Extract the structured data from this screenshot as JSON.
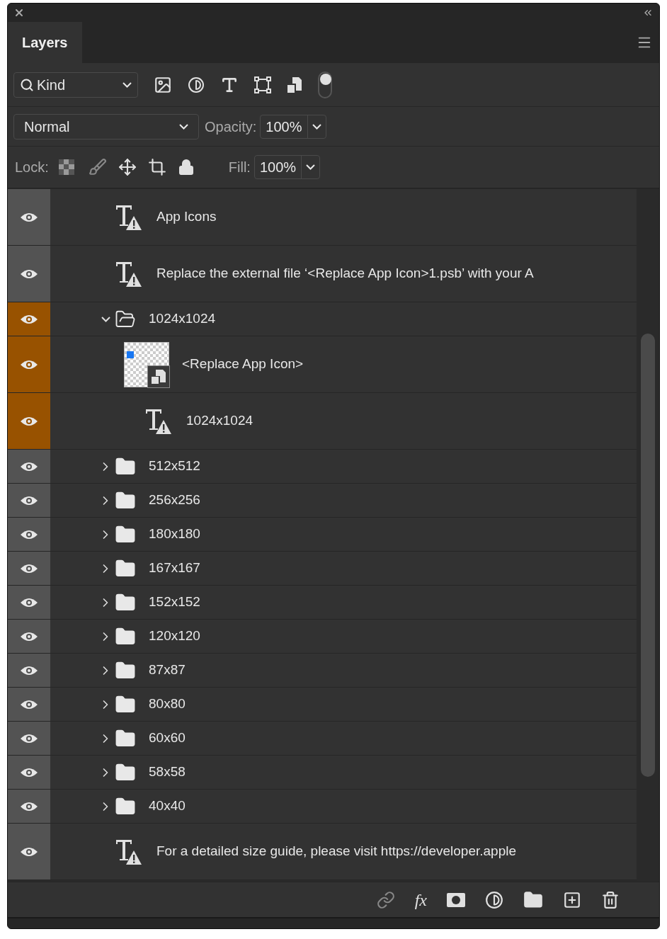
{
  "tab": {
    "label": "Layers",
    "selected": true
  },
  "filter": {
    "value": "Kind",
    "toggle_on": true
  },
  "blend": {
    "mode": "Normal",
    "opacity_label": "Opacity:",
    "opacity": "100%"
  },
  "lock": {
    "label": "Lock:",
    "fill_label": "Fill:",
    "fill": "100%"
  },
  "layers": [
    {
      "kind": "text",
      "name": "App Icons",
      "color": "#535353"
    },
    {
      "kind": "text",
      "name": "Replace the external file ‘<Replace App Icon>1.psb’ with your A",
      "color": "#535353"
    },
    {
      "kind": "folder",
      "name": "1024x1024",
      "color": "#985200",
      "expanded": true,
      "children": [
        {
          "kind": "smart",
          "name": "<Replace App Icon>",
          "color": "#985200"
        },
        {
          "kind": "text",
          "name": "1024x1024",
          "color": "#985200"
        }
      ]
    },
    {
      "kind": "folder",
      "name": "512x512",
      "color": "#535353",
      "expanded": false
    },
    {
      "kind": "folder",
      "name": "256x256",
      "color": "#535353",
      "expanded": false
    },
    {
      "kind": "folder",
      "name": "180x180",
      "color": "#535353",
      "expanded": false
    },
    {
      "kind": "folder",
      "name": "167x167",
      "color": "#535353",
      "expanded": false
    },
    {
      "kind": "folder",
      "name": "152x152",
      "color": "#535353",
      "expanded": false
    },
    {
      "kind": "folder",
      "name": "120x120",
      "color": "#535353",
      "expanded": false
    },
    {
      "kind": "folder",
      "name": "87x87",
      "color": "#535353",
      "expanded": false
    },
    {
      "kind": "folder",
      "name": "80x80",
      "color": "#535353",
      "expanded": false
    },
    {
      "kind": "folder",
      "name": "60x60",
      "color": "#535353",
      "expanded": false
    },
    {
      "kind": "folder",
      "name": "58x58",
      "color": "#535353",
      "expanded": false
    },
    {
      "kind": "folder",
      "name": "40x40",
      "color": "#535353",
      "expanded": false
    },
    {
      "kind": "text",
      "name": "For a detailed size guide, please visit https://developer.apple",
      "color": "#535353"
    }
  ],
  "footer": {
    "fx": "fx"
  }
}
